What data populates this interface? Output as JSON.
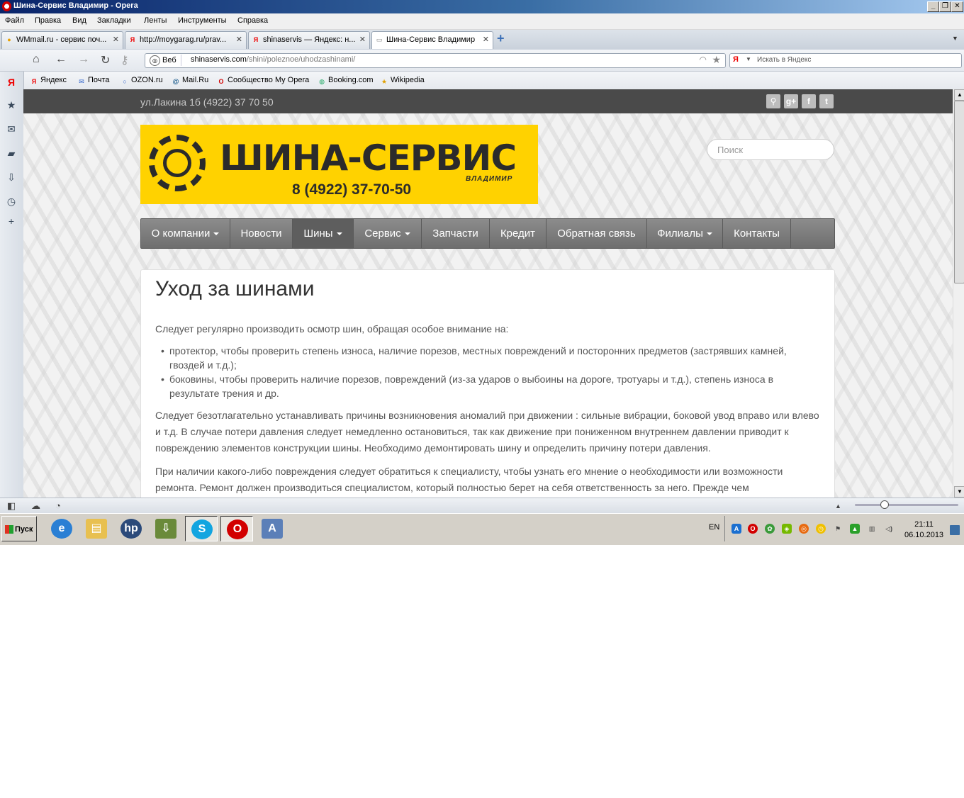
{
  "window": {
    "title": "Шина-Сервис Владимир - Opera"
  },
  "menu": [
    "Файл",
    "Правка",
    "Вид",
    "Закладки",
    "Ленты",
    "Инструменты",
    "Справка"
  ],
  "tabs": [
    {
      "label": "WMmail.ru - сервис поч...",
      "active": false
    },
    {
      "label": "http://moygarag.ru/prav...",
      "active": false
    },
    {
      "label": "shinaservis — Яндекс: н...",
      "active": false
    },
    {
      "label": "Шина-Сервис Владимир",
      "active": true
    }
  ],
  "address": {
    "badge": "Веб",
    "host": "shinaservis.com",
    "path": "/shini/poleznoe/uhodzashinami/"
  },
  "search": {
    "placeholder": "Искать в Яндекс"
  },
  "bookmarks": [
    "Яндекс",
    "Почта",
    "OZON.ru",
    "Mail.Ru",
    "Сообщество My Opera",
    "Booking.com",
    "Wikipedia"
  ],
  "site": {
    "address_line": "ул.Лакина 1б (4922) 37 70 50",
    "logo": {
      "name": "ШИНА-СЕРВИС",
      "city": "ВЛАДИМИР",
      "phone": "8 (4922) 37-70-50"
    },
    "search_placeholder": "Поиск",
    "nav": [
      {
        "label": "О компании",
        "dropdown": true
      },
      {
        "label": "Новости",
        "dropdown": false
      },
      {
        "label": "Шины",
        "dropdown": true,
        "active": true
      },
      {
        "label": "Сервис",
        "dropdown": true
      },
      {
        "label": "Запчасти",
        "dropdown": false
      },
      {
        "label": "Кредит",
        "dropdown": false
      },
      {
        "label": "Обратная связь",
        "dropdown": false
      },
      {
        "label": "Филиалы",
        "dropdown": true
      },
      {
        "label": "Контакты",
        "dropdown": false
      }
    ],
    "article": {
      "title": "Уход за шинами",
      "intro": "Следует регулярно производить осмотр шин, обращая особое внимание на:",
      "list": [
        "протектор, чтобы проверить степень износа, наличие порезов, местных повреждений и посторонних предметов (застрявших камней, гвоздей и т.д.);",
        "боковины, чтобы проверить наличие порезов, повреждений (из-за ударов о выбоины на дороге, тротуары и т.д.), степень износа в результате трения и др."
      ],
      "p2": "Следует безотлагательно устанавливать причины возникновения аномалий при движении : сильные вибрации, боковой увод вправо или влево и т.д. В случае потери давления следует немедленно остановиться, так как движение при пониженном внутреннем давлении приводит к повреждению элементов конструкции шины. Необходимо демонтировать шину и определить причину потери давления.",
      "p3": "При наличии какого-либо повреждения следует обратиться к специалисту, чтобы узнать его мнение о необходимости или возможности ремонта. Ремонт должен производиться специалистом, который полностью берет на себя ответственность за него. Прежде чем"
    },
    "colors": {
      "logo_bg": "#ffd200",
      "nav_bg": "#7d7d7d",
      "strip_bg": "#4a4a4a"
    }
  },
  "taskbar": {
    "start": "Пуск",
    "lang": "EN",
    "time": "21:11",
    "date": "06.10.2013"
  }
}
